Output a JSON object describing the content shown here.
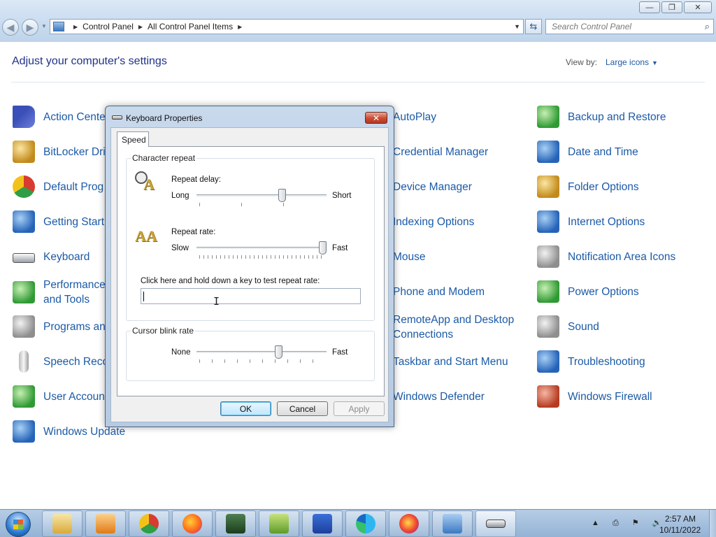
{
  "window": {
    "controls": [
      "—",
      "❐",
      "✕"
    ]
  },
  "nav": {
    "back_icon": "◀",
    "forward_icon": "▶",
    "breadcrumbs": [
      "Control Panel",
      "All Control Panel Items"
    ],
    "search_placeholder": "Search Control Panel"
  },
  "content": {
    "title": "Adjust your computer's settings",
    "view_by_label": "View by:",
    "view_by_value": "Large icons"
  },
  "items": [
    {
      "label": "Action Cente",
      "icon": "action-center-flag-icon"
    },
    {
      "label": "BitLocker Dri",
      "icon": "bitlocker-key-icon"
    },
    {
      "label": "Default Prog",
      "icon": "default-programs-icon"
    },
    {
      "label": "Getting Start",
      "icon": "getting-started-icon"
    },
    {
      "label": "Keyboard",
      "icon": "keyboard-icon"
    },
    {
      "label": "Performance",
      "label2": "and Tools",
      "icon": "performance-icon"
    },
    {
      "label": "Programs an",
      "icon": "programs-icon"
    },
    {
      "label": "Speech Reco",
      "icon": "microphone-icon"
    },
    {
      "label": "User Accoun",
      "icon": "user-accounts-icon"
    },
    {
      "label": "Windows Update",
      "icon": "windows-update-icon"
    },
    {
      "label": "AutoPlay",
      "icon": "autoplay-icon"
    },
    {
      "label": "Credential Manager",
      "icon": "credential-manager-icon"
    },
    {
      "label": "Device Manager",
      "icon": "device-manager-icon"
    },
    {
      "label": "Indexing Options",
      "icon": "indexing-options-icon"
    },
    {
      "label": "Mouse",
      "icon": "mouse-icon"
    },
    {
      "label": "Phone and Modem",
      "icon": "phone-modem-icon"
    },
    {
      "label": "RemoteApp and Desktop",
      "label2": "Connections",
      "icon": "remoteapp-icon"
    },
    {
      "label": "Taskbar and Start Menu",
      "icon": "taskbar-start-menu-icon"
    },
    {
      "label": "Windows Defender",
      "icon": "windows-defender-icon"
    },
    {
      "label": "Backup and Restore",
      "icon": "backup-restore-icon"
    },
    {
      "label": "Date and Time",
      "icon": "date-time-icon"
    },
    {
      "label": "Folder Options",
      "icon": "folder-options-icon"
    },
    {
      "label": "Internet Options",
      "icon": "internet-options-icon"
    },
    {
      "label": "Notification Area Icons",
      "icon": "notification-area-icon"
    },
    {
      "label": "Power Options",
      "icon": "power-options-icon"
    },
    {
      "label": "Sound",
      "icon": "sound-icon"
    },
    {
      "label": "Troubleshooting",
      "icon": "troubleshooting-icon"
    },
    {
      "label": "Windows Firewall",
      "icon": "windows-firewall-icon"
    }
  ],
  "dialog": {
    "title": "Keyboard Properties",
    "close_glyph": "✕",
    "tab": "Speed",
    "char_repeat": {
      "group_label": "Character repeat",
      "delay_label": "Repeat delay:",
      "delay_left": "Long",
      "delay_right": "Short",
      "delay_value": 0.67,
      "rate_label": "Repeat rate:",
      "rate_left": "Slow",
      "rate_right": "Fast",
      "rate_value": 1.0,
      "test_label": "Click here and hold down a key to test repeat rate:"
    },
    "cursor_blink": {
      "group_label": "Cursor blink rate",
      "left": "None",
      "right": "Fast",
      "value": 0.64
    },
    "buttons": {
      "ok": "OK",
      "cancel": "Cancel",
      "apply": "Apply"
    }
  },
  "taskbar": {
    "apps": [
      "file-explorer-icon",
      "media-player-icon",
      "chrome-icon",
      "firefox-icon",
      "task-manager-icon",
      "notepad-icon",
      "malwarebytes-icon",
      "edge-icon",
      "firefox-alt-icon",
      "control-panel-icon",
      "keyboard-properties-icon"
    ],
    "tray_glyphs": "▲ ⎙ ⚑ 🔊",
    "time": "2:57 AM",
    "date": "10/11/2022"
  }
}
